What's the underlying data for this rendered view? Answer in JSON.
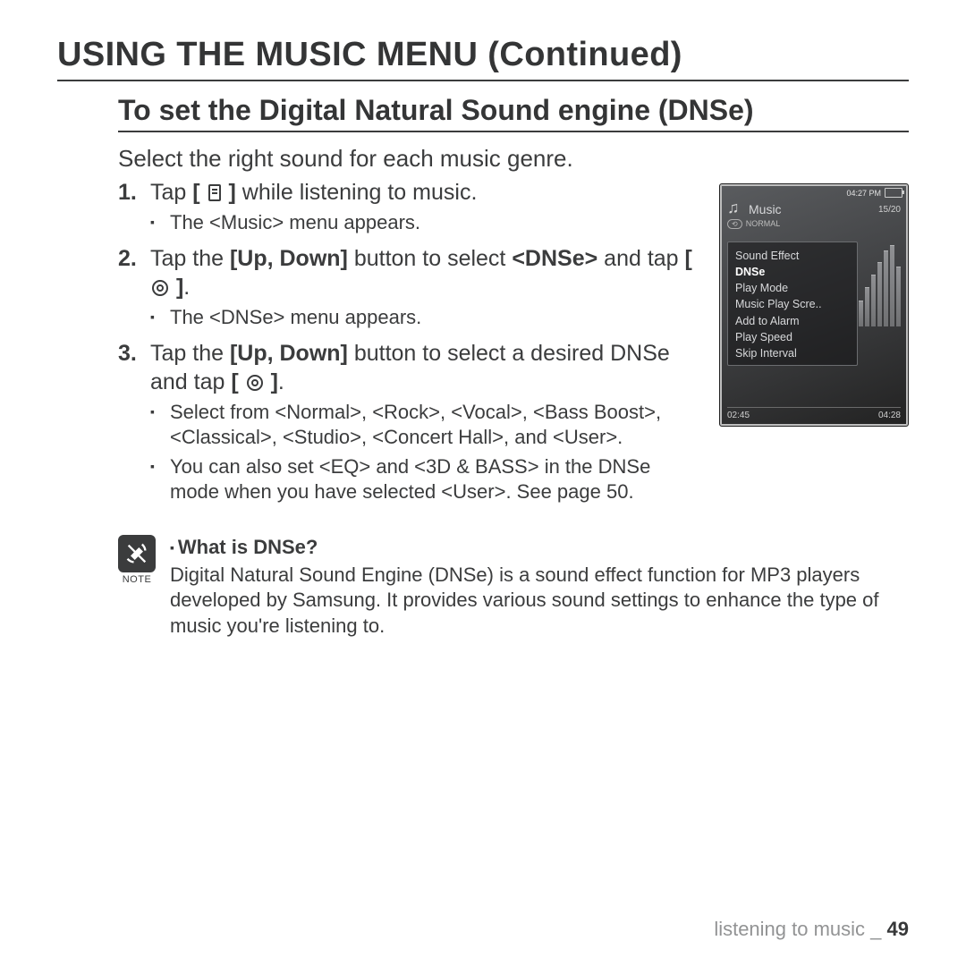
{
  "title": "USING THE MUSIC MENU (Continued)",
  "subtitle": "To set the Digital Natural Sound engine (DNSe)",
  "intro": "Select the right sound for each music genre.",
  "steps": {
    "s1": {
      "pre": "Tap ",
      "bpre": "[ ",
      "bpost": " ]",
      "post": " while listening to music."
    },
    "s1_sub": "The <Music> menu appears.",
    "s2": {
      "pre": "Tap the ",
      "bold1": "[Up, Down]",
      "mid1": " button to select ",
      "bold2": "<DNSe>",
      "mid2": " and tap ",
      "bpre": "[ ",
      "bpost": " ]",
      "end": "."
    },
    "s2_sub": "The <DNSe> menu appears.",
    "s3": {
      "pre": "Tap the ",
      "bold1": "[Up, Down]",
      "mid1": " button to select a desired DNSe and tap ",
      "bpre": "[ ",
      "bpost": " ]",
      "end": "."
    },
    "s3_sub1": "Select from <Normal>, <Rock>, <Vocal>, <Bass Boost>, <Classical>, <Studio>, <Concert Hall>, and <User>.",
    "s3_sub2": "You can also set <EQ> and <3D & BASS> in the DNSe mode when you have selected <User>. See page 50."
  },
  "note": {
    "label": "NOTE",
    "heading": "What is DNSe?",
    "body": "Digital Natural Sound Engine (DNSe) is a sound effect function for MP3 players developed by Samsung. It provides various sound settings to enhance the type of music you're listening to."
  },
  "device": {
    "time": "04:27 PM",
    "header": "Music",
    "count": "15/20",
    "mode": "NORMAL",
    "menu": [
      "Sound Effect",
      "DNSe",
      "Play Mode",
      "Music Play Scre..",
      "Add to Alarm",
      "Play Speed",
      "Skip Interval"
    ],
    "selected_index": 1,
    "time_l": "02:45",
    "time_r": "04:28"
  },
  "footer": {
    "section": "listening to music _ ",
    "page": "49"
  }
}
